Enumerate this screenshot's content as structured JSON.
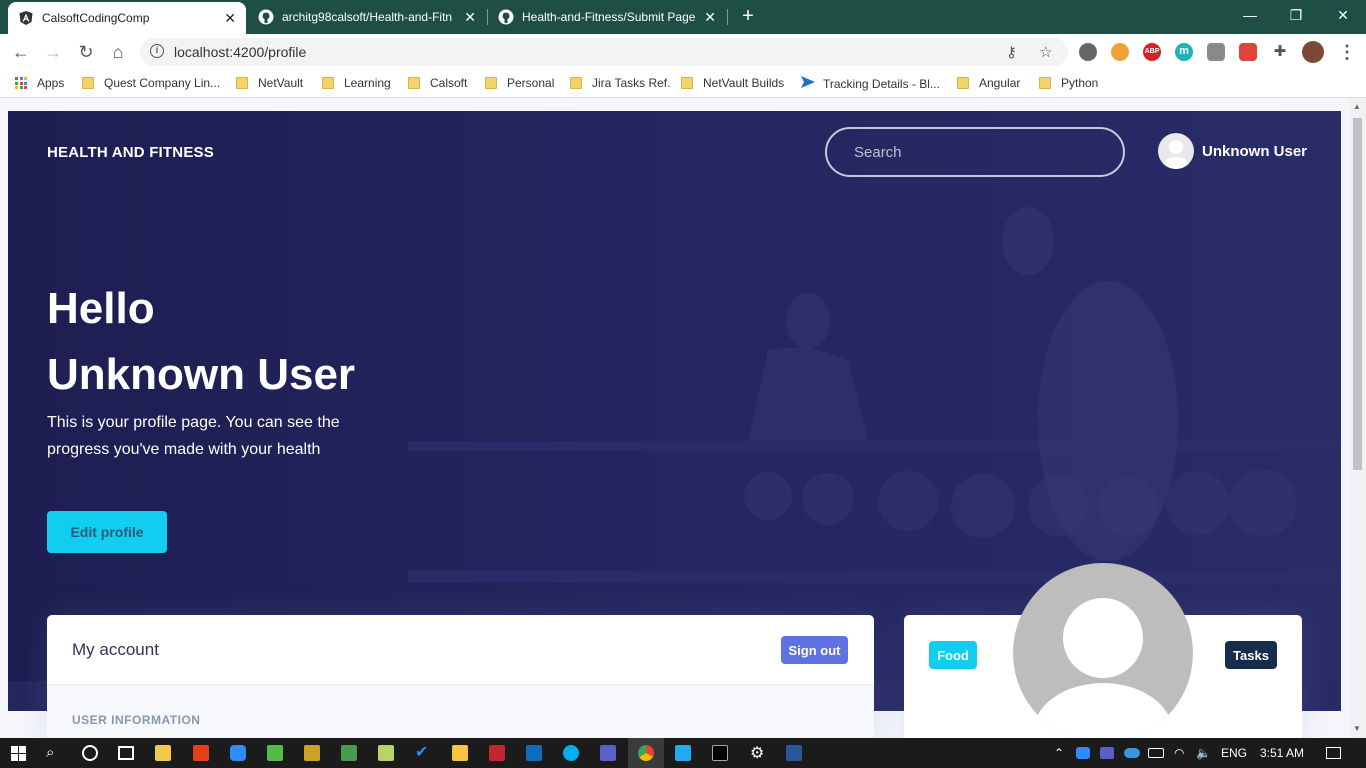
{
  "browser": {
    "tabs": [
      {
        "title": "CalsoftCodingComp",
        "active": true
      },
      {
        "title": "architg98calsoft/Health-and-Fitn",
        "active": false
      },
      {
        "title": "Health-and-Fitness/Submit Page.",
        "active": false
      }
    ],
    "url": "localhost:4200/profile",
    "bookmarks": [
      "Apps",
      "Quest Company Lin...",
      "NetVault",
      "Learning",
      "Calsoft",
      "Personal",
      "Jira Tasks Ref.",
      "NetVault Builds",
      "Tracking Details - Bl...",
      "Angular",
      "Python"
    ],
    "extension_badges": {
      "abp": "ABP",
      "m": "m"
    }
  },
  "page": {
    "brand": "HEALTH AND FITNESS",
    "search_placeholder": "Search",
    "user_name": "Unknown User",
    "hero": {
      "hello": "Hello",
      "name": "Unknown User",
      "description": "This is your profile page. You can see the progress you've made with your health",
      "edit_button": "Edit profile"
    },
    "account_card": {
      "title": "My account",
      "sign_out": "Sign out",
      "section_label": "USER INFORMATION"
    },
    "profile_card": {
      "food_badge": "Food",
      "tasks_badge": "Tasks"
    }
  },
  "taskbar": {
    "language": "ENG",
    "time": "3:51 AM"
  },
  "colors": {
    "hero_bg": "#1e1f55",
    "accent_cyan": "#11cdef",
    "primary": "#5e72e4",
    "dark_badge": "#172b4d",
    "tab_strip": "#1f4e45"
  }
}
